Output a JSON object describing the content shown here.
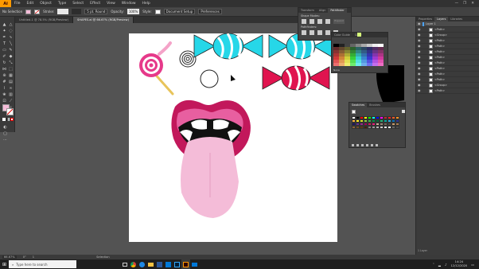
{
  "app": {
    "logo": "Ai",
    "menus": [
      "File",
      "Edit",
      "Object",
      "Type",
      "Select",
      "Effect",
      "View",
      "Window",
      "Help"
    ],
    "window_buttons": [
      "—",
      "❐",
      "✕"
    ]
  },
  "controlbar": {
    "selection_label": "No Selection",
    "stroke_label": "Stroke:",
    "stroke_value": "",
    "brush_value": "5 pt. Round",
    "opacity_label": "Opacity:",
    "opacity_value": "100%",
    "style_label": "Style:",
    "document_setup": "Document Setup",
    "preferences": "Preferences"
  },
  "tabs": [
    {
      "label": "Untitled-1 @ 78.5% (RGB/Preview)",
      "active": false
    },
    {
      "label": "SHAPES.ai @ 66.67% (RGB/Preview)",
      "active": true
    }
  ],
  "pathfinder": {
    "tabs": [
      "Transform",
      "Align",
      "Pathfinder"
    ],
    "shape_modes_label": "Shape Modes:",
    "pathfinders_label": "Pathfinders:",
    "expand_label": "Expand"
  },
  "color_panel": {
    "tabs": [
      "Color Guide",
      "Color",
      "Swatches"
    ],
    "none_label": "None"
  },
  "swatches_panel": {
    "tabs": [
      "Swatches",
      "Brushes"
    ]
  },
  "layers_panel": {
    "tabs": [
      "Properties",
      "Layers",
      "Libraries"
    ],
    "layer_name": "Layer 1",
    "items": [
      "<Path>",
      "<Group>",
      "<Path>",
      "<Path>",
      "<Path>",
      "<Path>",
      "<Path>",
      "<Path>",
      "<Path>",
      "<Path>",
      "<Group>",
      "<Path>"
    ],
    "footer": "1 Layer"
  },
  "statusbar": {
    "zoom": "66.67%",
    "rotation": "0°",
    "artboard": "1",
    "tool": "Selection"
  },
  "taskbar": {
    "search_placeholder": "Type here to search",
    "time": "14:24",
    "date": "12/12/2020"
  },
  "colors": {
    "lip": "#c2185b",
    "tongue": "#f4bcd8",
    "candy_cyan": "#26d7e8",
    "candy_red": "#e0144f",
    "lollipop_pink": "#e6398a",
    "stick": "#e8c45a"
  }
}
